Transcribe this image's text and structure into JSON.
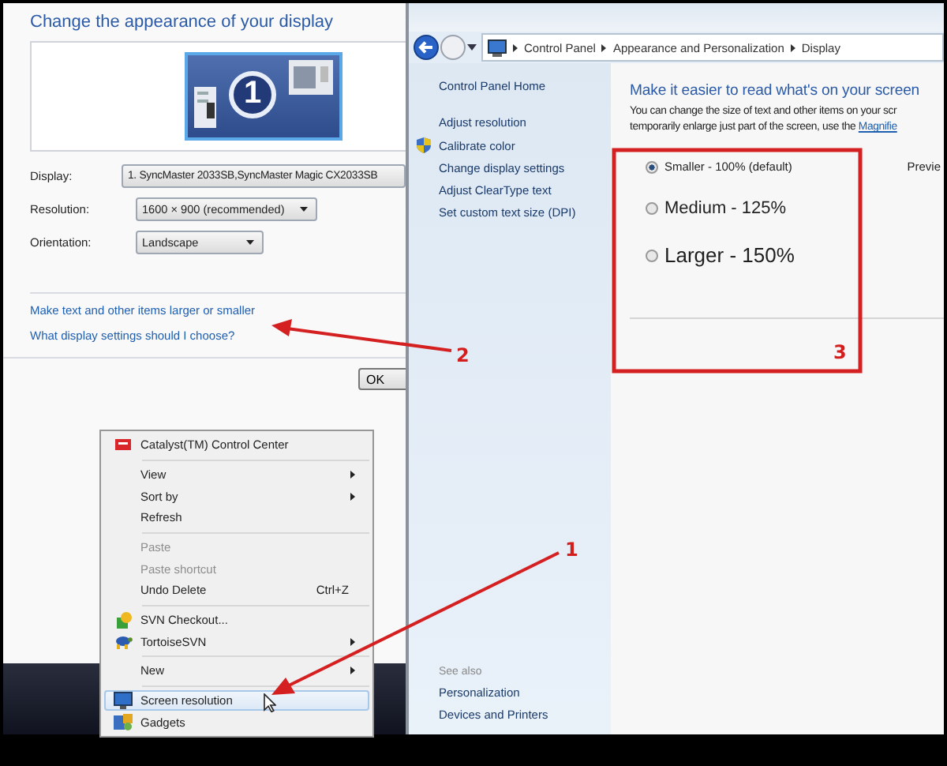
{
  "display_settings": {
    "title": "Change the appearance of your display",
    "monitor_number": "1",
    "fields": [
      {
        "label": "Display:",
        "value": "1. SyncMaster 2033SB,SyncMaster Magic CX2033SB"
      },
      {
        "label": "Resolution:",
        "value": "1600 × 900 (recommended)"
      },
      {
        "label": "Orientation:",
        "value": "Landscape"
      }
    ],
    "links": [
      "Make text and other items larger or smaller",
      "What display settings should I choose?"
    ],
    "ok_button": "OK"
  },
  "control_panel": {
    "breadcrumbs": [
      "Control Panel",
      "Appearance and Personalization",
      "Display"
    ],
    "sidebar": {
      "items": [
        {
          "label": "Control Panel Home",
          "kind": "home"
        },
        {
          "label": "Adjust resolution",
          "kind": "link"
        },
        {
          "label": "Calibrate color",
          "kind": "admin"
        },
        {
          "label": "Change display settings",
          "kind": "link"
        },
        {
          "label": "Adjust ClearType text",
          "kind": "link"
        },
        {
          "label": "Set custom text size (DPI)",
          "kind": "link"
        }
      ],
      "see_also_label": "See also",
      "see_also": [
        "Personalization",
        "Devices and Printers"
      ]
    },
    "heading": "Make it easier to read what's on your screen",
    "description_line_1": "You can change the size of text and other items on your scr",
    "description_line_2": "temporarily enlarge just part of the screen, use the ",
    "description_link": "Magnifie",
    "options": [
      {
        "label": "Smaller - 100% (default)",
        "selected": true
      },
      {
        "label": "Medium - 125%",
        "selected": false
      },
      {
        "label": "Larger - 150%",
        "selected": false
      }
    ],
    "preview_label": "Previe"
  },
  "context_menu": {
    "items": [
      {
        "kind": "ati",
        "label": "Catalyst(TM) Control Center",
        "disabled": false,
        "submenu": false,
        "selected": false
      },
      {
        "kind": "separator"
      },
      {
        "kind": "plain",
        "label": "View",
        "disabled": false,
        "submenu": true,
        "selected": false
      },
      {
        "kind": "plain",
        "label": "Sort by",
        "disabled": false,
        "submenu": true,
        "selected": false
      },
      {
        "kind": "plain",
        "label": "Refresh",
        "disabled": false,
        "submenu": false,
        "selected": false
      },
      {
        "kind": "separator"
      },
      {
        "kind": "plain",
        "label": "Paste",
        "disabled": true,
        "submenu": false,
        "selected": false
      },
      {
        "kind": "plain",
        "label": "Paste shortcut",
        "disabled": true,
        "submenu": false,
        "selected": false
      },
      {
        "kind": "plain",
        "label": "Undo Delete",
        "shortcut": "Ctrl+Z",
        "disabled": false,
        "submenu": false,
        "selected": false
      },
      {
        "kind": "separator"
      },
      {
        "kind": "svn",
        "label": "SVN Checkout...",
        "disabled": false,
        "submenu": false,
        "selected": false
      },
      {
        "kind": "tortoise",
        "label": "TortoiseSVN",
        "disabled": false,
        "submenu": true,
        "selected": false
      },
      {
        "kind": "separator"
      },
      {
        "kind": "plain",
        "label": "New",
        "disabled": false,
        "submenu": true,
        "selected": false
      },
      {
        "kind": "separator"
      },
      {
        "kind": "display",
        "label": "Screen resolution",
        "disabled": false,
        "submenu": false,
        "selected": true
      },
      {
        "kind": "gadgets",
        "label": "Gadgets",
        "disabled": false,
        "submenu": false,
        "selected": false
      }
    ]
  },
  "annotations": [
    {
      "label": "1"
    },
    {
      "label": "2"
    },
    {
      "label": "3"
    }
  ]
}
